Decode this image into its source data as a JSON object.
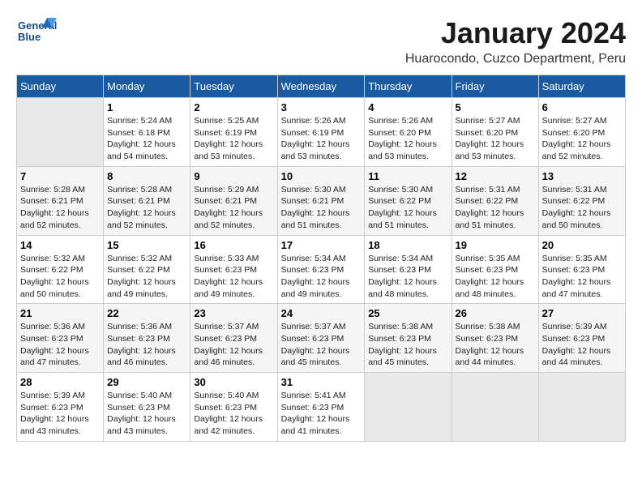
{
  "logo": {
    "line1": "General",
    "line2": "Blue"
  },
  "title": "January 2024",
  "subtitle": "Huarocondo, Cuzco Department, Peru",
  "days_of_week": [
    "Sunday",
    "Monday",
    "Tuesday",
    "Wednesday",
    "Thursday",
    "Friday",
    "Saturday"
  ],
  "weeks": [
    [
      {
        "day": "",
        "info": ""
      },
      {
        "day": "1",
        "info": "Sunrise: 5:24 AM\nSunset: 6:18 PM\nDaylight: 12 hours\nand 54 minutes."
      },
      {
        "day": "2",
        "info": "Sunrise: 5:25 AM\nSunset: 6:19 PM\nDaylight: 12 hours\nand 53 minutes."
      },
      {
        "day": "3",
        "info": "Sunrise: 5:26 AM\nSunset: 6:19 PM\nDaylight: 12 hours\nand 53 minutes."
      },
      {
        "day": "4",
        "info": "Sunrise: 5:26 AM\nSunset: 6:20 PM\nDaylight: 12 hours\nand 53 minutes."
      },
      {
        "day": "5",
        "info": "Sunrise: 5:27 AM\nSunset: 6:20 PM\nDaylight: 12 hours\nand 53 minutes."
      },
      {
        "day": "6",
        "info": "Sunrise: 5:27 AM\nSunset: 6:20 PM\nDaylight: 12 hours\nand 52 minutes."
      }
    ],
    [
      {
        "day": "7",
        "info": "Sunrise: 5:28 AM\nSunset: 6:21 PM\nDaylight: 12 hours\nand 52 minutes."
      },
      {
        "day": "8",
        "info": "Sunrise: 5:28 AM\nSunset: 6:21 PM\nDaylight: 12 hours\nand 52 minutes."
      },
      {
        "day": "9",
        "info": "Sunrise: 5:29 AM\nSunset: 6:21 PM\nDaylight: 12 hours\nand 52 minutes."
      },
      {
        "day": "10",
        "info": "Sunrise: 5:30 AM\nSunset: 6:21 PM\nDaylight: 12 hours\nand 51 minutes."
      },
      {
        "day": "11",
        "info": "Sunrise: 5:30 AM\nSunset: 6:22 PM\nDaylight: 12 hours\nand 51 minutes."
      },
      {
        "day": "12",
        "info": "Sunrise: 5:31 AM\nSunset: 6:22 PM\nDaylight: 12 hours\nand 51 minutes."
      },
      {
        "day": "13",
        "info": "Sunrise: 5:31 AM\nSunset: 6:22 PM\nDaylight: 12 hours\nand 50 minutes."
      }
    ],
    [
      {
        "day": "14",
        "info": "Sunrise: 5:32 AM\nSunset: 6:22 PM\nDaylight: 12 hours\nand 50 minutes."
      },
      {
        "day": "15",
        "info": "Sunrise: 5:32 AM\nSunset: 6:22 PM\nDaylight: 12 hours\nand 49 minutes."
      },
      {
        "day": "16",
        "info": "Sunrise: 5:33 AM\nSunset: 6:23 PM\nDaylight: 12 hours\nand 49 minutes."
      },
      {
        "day": "17",
        "info": "Sunrise: 5:34 AM\nSunset: 6:23 PM\nDaylight: 12 hours\nand 49 minutes."
      },
      {
        "day": "18",
        "info": "Sunrise: 5:34 AM\nSunset: 6:23 PM\nDaylight: 12 hours\nand 48 minutes."
      },
      {
        "day": "19",
        "info": "Sunrise: 5:35 AM\nSunset: 6:23 PM\nDaylight: 12 hours\nand 48 minutes."
      },
      {
        "day": "20",
        "info": "Sunrise: 5:35 AM\nSunset: 6:23 PM\nDaylight: 12 hours\nand 47 minutes."
      }
    ],
    [
      {
        "day": "21",
        "info": "Sunrise: 5:36 AM\nSunset: 6:23 PM\nDaylight: 12 hours\nand 47 minutes."
      },
      {
        "day": "22",
        "info": "Sunrise: 5:36 AM\nSunset: 6:23 PM\nDaylight: 12 hours\nand 46 minutes."
      },
      {
        "day": "23",
        "info": "Sunrise: 5:37 AM\nSunset: 6:23 PM\nDaylight: 12 hours\nand 46 minutes."
      },
      {
        "day": "24",
        "info": "Sunrise: 5:37 AM\nSunset: 6:23 PM\nDaylight: 12 hours\nand 45 minutes."
      },
      {
        "day": "25",
        "info": "Sunrise: 5:38 AM\nSunset: 6:23 PM\nDaylight: 12 hours\nand 45 minutes."
      },
      {
        "day": "26",
        "info": "Sunrise: 5:38 AM\nSunset: 6:23 PM\nDaylight: 12 hours\nand 44 minutes."
      },
      {
        "day": "27",
        "info": "Sunrise: 5:39 AM\nSunset: 6:23 PM\nDaylight: 12 hours\nand 44 minutes."
      }
    ],
    [
      {
        "day": "28",
        "info": "Sunrise: 5:39 AM\nSunset: 6:23 PM\nDaylight: 12 hours\nand 43 minutes."
      },
      {
        "day": "29",
        "info": "Sunrise: 5:40 AM\nSunset: 6:23 PM\nDaylight: 12 hours\nand 43 minutes."
      },
      {
        "day": "30",
        "info": "Sunrise: 5:40 AM\nSunset: 6:23 PM\nDaylight: 12 hours\nand 42 minutes."
      },
      {
        "day": "31",
        "info": "Sunrise: 5:41 AM\nSunset: 6:23 PM\nDaylight: 12 hours\nand 41 minutes."
      },
      {
        "day": "",
        "info": ""
      },
      {
        "day": "",
        "info": ""
      },
      {
        "day": "",
        "info": ""
      }
    ]
  ]
}
